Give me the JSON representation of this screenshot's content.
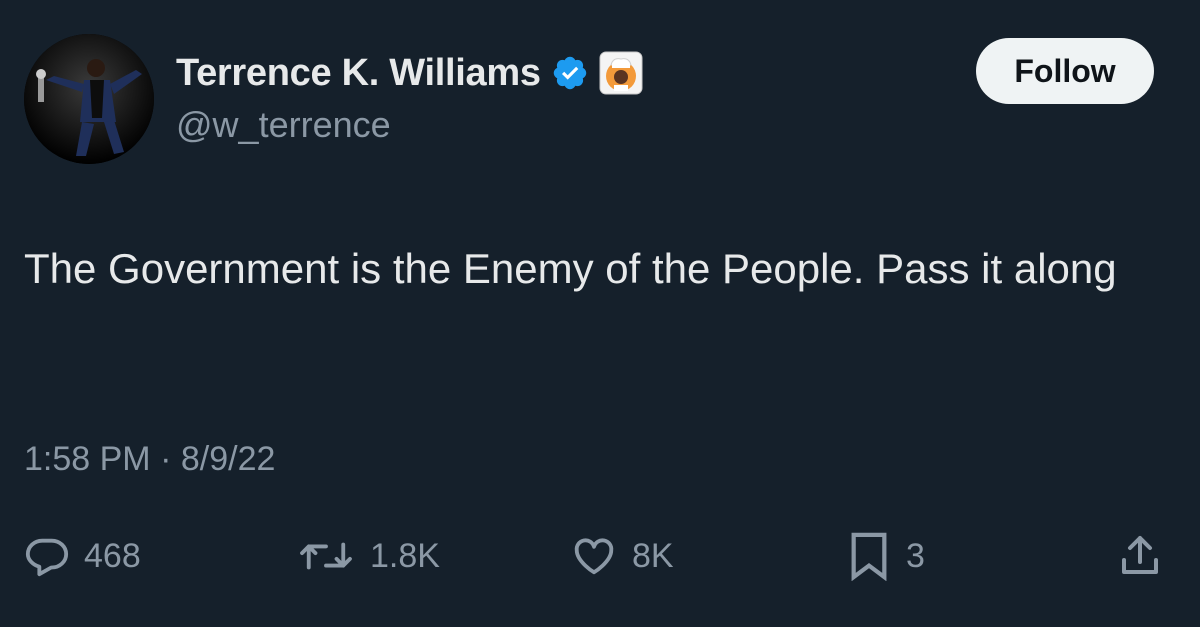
{
  "author": {
    "display_name": "Terrence K. Williams",
    "handle": "@w_terrence",
    "verified_icon": "verified-badge-icon",
    "affiliate_icon": "chef-avatar-badge-icon"
  },
  "follow_button": {
    "label": "Follow"
  },
  "tweet": {
    "text": "The Government is the Enemy of the People. Pass it along",
    "time": "1:58 PM",
    "separator": "·",
    "date": "8/9/22"
  },
  "actions": {
    "reply_count": "468",
    "retweet_count": "1.8K",
    "like_count": "8K",
    "bookmark_count": "3"
  },
  "colors": {
    "background": "#15202b",
    "primary_text": "#e7e9ea",
    "secondary_text": "#8b98a5",
    "verified": "#1d9bf0",
    "follow_bg": "#eff3f4"
  }
}
